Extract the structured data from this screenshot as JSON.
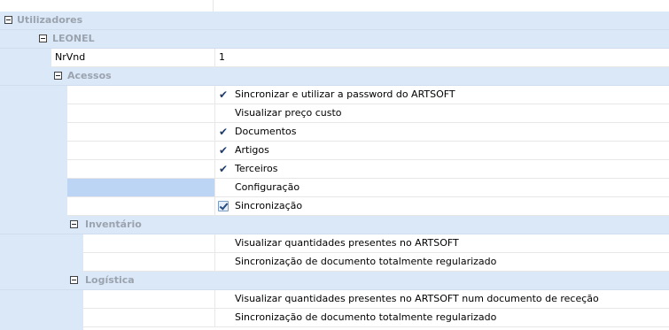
{
  "tree": {
    "root": "Utilizadores",
    "user": "LEONEL",
    "nrvnd": {
      "label": "NrVnd",
      "value": "1"
    },
    "acessos": {
      "label": "Acessos",
      "items": [
        {
          "label": "Sincronizar e utilizar a password do ARTSOFT",
          "checked": true
        },
        {
          "label": "Visualizar preço custo",
          "checked": false
        },
        {
          "label": "Documentos",
          "checked": true
        },
        {
          "label": "Artigos",
          "checked": true
        },
        {
          "label": "Terceiros",
          "checked": true
        },
        {
          "label": "Configuração",
          "checked": false
        },
        {
          "label": "Sincronização",
          "checked": true
        }
      ]
    },
    "inventario": {
      "label": "Inventário",
      "items": [
        {
          "label": "Visualizar quantidades presentes no ARTSOFT"
        },
        {
          "label": "Sincronização de documento totalmente regularizado"
        }
      ]
    },
    "logistica": {
      "label": "Logística",
      "items": [
        {
          "label": "Visualizar quantidades presentes no ARTSOFT num documento de receção"
        },
        {
          "label": "Sincronização de documento totalmente regularizado"
        }
      ]
    }
  },
  "colors": {
    "category_bg": "#dbe8f8",
    "selected_bg": "#bcd5f4",
    "category_text": "#9aa3ae"
  }
}
